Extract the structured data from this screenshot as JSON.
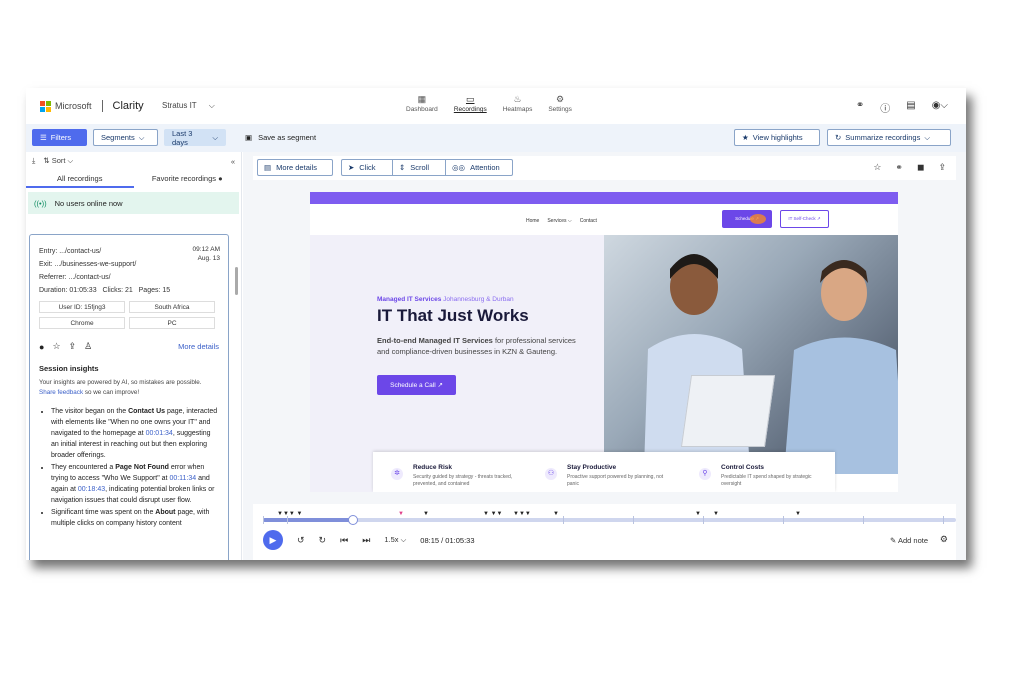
{
  "app": {
    "ms_label": "Microsoft",
    "product": "Clarity",
    "project": "Stratus IT",
    "project_chev": "⌵"
  },
  "nav": [
    {
      "label": "Dashboard",
      "icon": "dashboard-icon",
      "glyph": "▦"
    },
    {
      "label": "Recordings",
      "icon": "camera-icon",
      "glyph": "▭"
    },
    {
      "label": "Heatmaps",
      "icon": "flame-icon",
      "glyph": "♨"
    },
    {
      "label": "Settings",
      "icon": "gear-icon",
      "glyph": "⚙"
    }
  ],
  "toolbar": {
    "filters": "Filters",
    "segments": "Segments",
    "date": "Last 3 days",
    "save_segment": "Save as segment",
    "view_highlights": "View highlights",
    "summarize": "Summarize recordings"
  },
  "sidebar": {
    "sort": "Sort",
    "tab_all": "All recordings",
    "tab_fav": "Favorite recordings",
    "online": "No users online now"
  },
  "session": {
    "entry": "Entry: .../contact-us/",
    "exit": "Exit: .../businesses-we-support/",
    "referrer": "Referrer: .../contact-us/",
    "duration": "Duration: 01:05:33",
    "clicks": "Clicks: 21",
    "pages": "Pages: 15",
    "time": "09:12 AM",
    "date": "Aug. 13",
    "user_id": "User ID: 15fjng3",
    "country": "South Africa",
    "browser": "Chrome",
    "device": "PC",
    "more_details": "More details",
    "insights_title": "Session insights",
    "disclaimer": "Your insights are powered by AI, so mistakes are possible.",
    "feedback_link": "Share feedback",
    "feedback_tail": " so we can improve!",
    "b1a": "The visitor began on the ",
    "b1b": "Contact Us",
    "b1c": " page, interacted with elements like \"When no one owns your IT\" and navigated to the homepage at ",
    "b1t": "00:01:34",
    "b1d": ", suggesting an initial interest in reaching out but then exploring broader offerings.",
    "b2a": "They encountered a ",
    "b2b": "Page Not Found",
    "b2c": " error when trying to access \"Who We Support\" at ",
    "b2t1": "00:11:34",
    "b2d": " and again at ",
    "b2t2": "00:18:43",
    "b2e": ", indicating potential broken links or navigation issues that could disrupt user flow.",
    "b3a": "Significant time was spent on the ",
    "b3b": "About",
    "b3c": " page, with multiple clicks on company history content"
  },
  "viewer": {
    "more_details": "More details",
    "click": "Click",
    "scroll": "Scroll",
    "attention": "Attention"
  },
  "site": {
    "nav_home": "Home",
    "nav_services": "Services ⌵",
    "nav_contact": "Contact",
    "btn_schedule": "Schedule ↗",
    "btn_selfcheck": "IT Self-Check ↗",
    "kicker_a": "Managed IT Services ",
    "kicker_b": "Johannesburg & Durban",
    "headline": "IT That Just Works",
    "sub_bold": "End-to-end Managed IT Services",
    "sub_rest": " for professional services and compliance-driven businesses in KZN & Gauteng.",
    "cta": "Schedule a Call ↗",
    "features": [
      {
        "title": "Reduce Risk",
        "desc": "Security guided by strategy - threats tracked, prevented, and contained"
      },
      {
        "title": "Stay Productive",
        "desc": "Proactive support powered by planning, not panic"
      },
      {
        "title": "Control Costs",
        "desc": "Predictable IT spend shaped by strategic oversight"
      }
    ]
  },
  "player": {
    "progress": 0.13,
    "speed": "1.5x",
    "time": "08:15 / 01:05:33",
    "add_note": "Add note"
  },
  "colors": {
    "accent": "#4f6bed",
    "site_purple": "#6c47e8"
  }
}
